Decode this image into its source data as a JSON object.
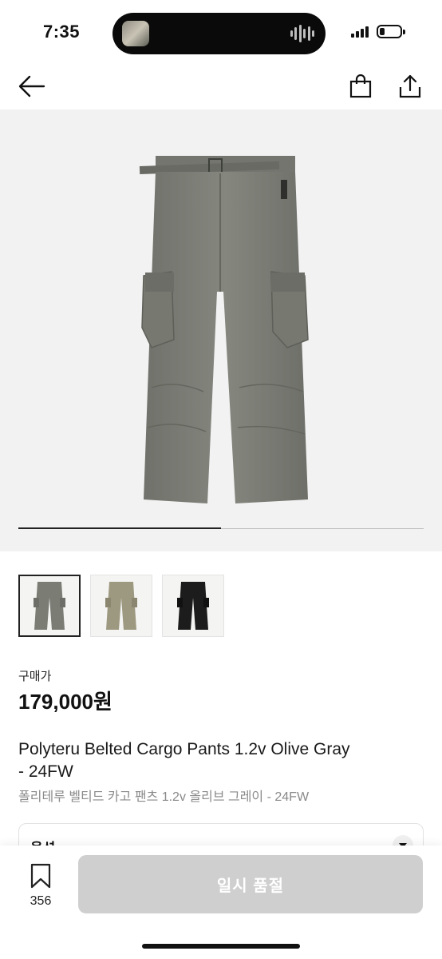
{
  "status_bar": {
    "time": "7:35",
    "icons": [
      "music-thumbnail-icon",
      "audio-wave-icon",
      "cellular-signal-icon",
      "battery-icon"
    ],
    "battery_level": 0.25
  },
  "header": {
    "icons": [
      "back-arrow-icon",
      "shopping-bag-icon",
      "share-icon"
    ]
  },
  "hero": {
    "image": "olive-gray-cargo-pants",
    "carousel_progress": 0.5,
    "colors": {
      "background": "#f2f2f2",
      "pants": "#7a7c74"
    }
  },
  "thumbnails": [
    {
      "color_name": "olive-gray",
      "color": "#7b7d75",
      "selected": true
    },
    {
      "color_name": "khaki",
      "color": "#9d9880",
      "selected": false
    },
    {
      "color_name": "black",
      "color": "#1c1c1c",
      "selected": false
    }
  ],
  "product": {
    "price_label": "구매가",
    "price": "179,000원",
    "title_en_line1": "Polyteru Belted Cargo Pants 1.2v Olive Gray",
    "title_en_line2": "- 24FW",
    "title_ko": "폴리테루 벨티드 카고 팬츠 1.2v 올리브 그레이 - 24FW"
  },
  "option": {
    "label": "옵션"
  },
  "bottom_bar": {
    "wish_count": "356",
    "cta_label": "일시 품절",
    "cta_color": "#cfcfcf"
  }
}
